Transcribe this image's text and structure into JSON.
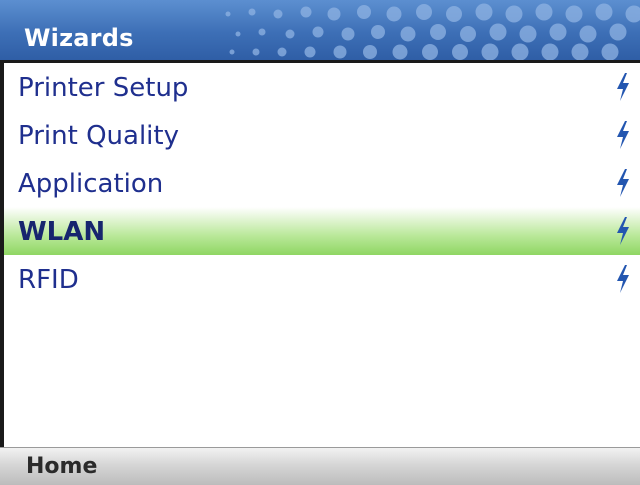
{
  "header": {
    "title": "Wizards"
  },
  "menu": {
    "items": [
      {
        "label": "Printer Setup",
        "icon": "lightning-bolt-icon",
        "selected": false
      },
      {
        "label": "Print Quality",
        "icon": "lightning-bolt-icon",
        "selected": false
      },
      {
        "label": "Application",
        "icon": "lightning-bolt-icon",
        "selected": false
      },
      {
        "label": "WLAN",
        "icon": "lightning-bolt-icon",
        "selected": true
      },
      {
        "label": "RFID",
        "icon": "lightning-bolt-icon",
        "selected": false
      }
    ]
  },
  "footer": {
    "softkey_left": "Home"
  },
  "colors": {
    "header_blue": "#3d6fb6",
    "item_text": "#1f2f8e",
    "selection_green": "#8fd663",
    "bolt_blue": "#2356b0"
  }
}
